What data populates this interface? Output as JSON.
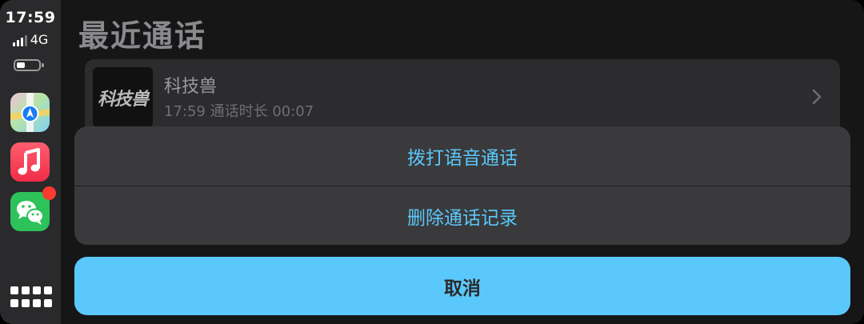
{
  "status": {
    "time": "17:59",
    "network": "4G",
    "signal_bars": 4,
    "signal_bars_active": 3,
    "battery_level": 0.4
  },
  "dock": {
    "apps": [
      {
        "name": "maps",
        "icon": "maps-icon"
      },
      {
        "name": "music",
        "icon": "music-icon"
      },
      {
        "name": "wechat",
        "icon": "wechat-icon",
        "has_badge": true
      }
    ],
    "home_icon": "app-grid-icon"
  },
  "page": {
    "title": "最近通话"
  },
  "recent_call": {
    "avatar_text": "科技兽",
    "name": "科技兽",
    "meta": "17:59 通话时长 00:07"
  },
  "action_sheet": {
    "voice_call_label": "拨打语音通话",
    "delete_label": "删除通话记录",
    "cancel_label": "取消"
  },
  "colors": {
    "accent": "#5ac8fa",
    "badge": "#ff3b30",
    "sheet_bg": "#3a3a3c"
  }
}
